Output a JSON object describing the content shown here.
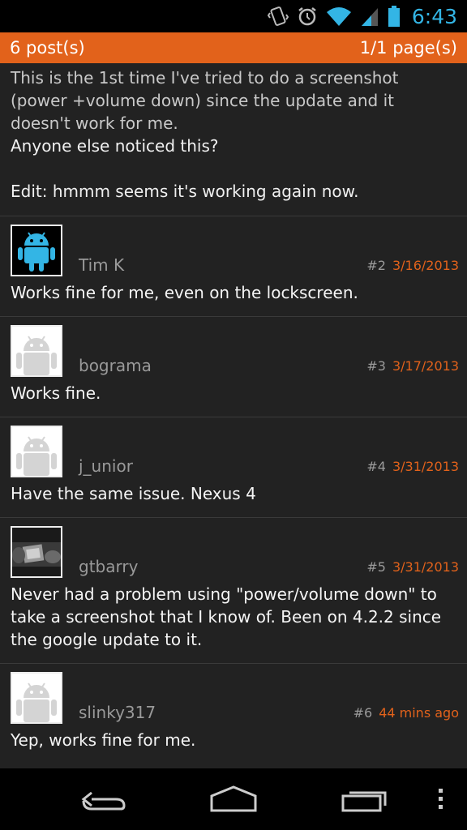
{
  "status_bar": {
    "time": "6:43",
    "icons": [
      "vibrate-icon",
      "alarm-icon",
      "wifi-icon",
      "signal-icon",
      "battery-icon"
    ],
    "accent_color": "#33b5e5"
  },
  "header": {
    "posts_count": "6 post(s)",
    "pages": "1/1 page(s)",
    "color": "#e2621b"
  },
  "first_post": {
    "line1": "This is the 1st time I've tried to do a screenshot (power +volume down) since the update and it doesn't work for me.",
    "line2": "Anyone else noticed this?",
    "line3": "Edit: hmmm seems it's working again now."
  },
  "posts": [
    {
      "author": "Tim K",
      "num": "#2",
      "date": "3/16/2013",
      "body": "Works fine for me, even on the lockscreen.",
      "avatar": "android-blue-icon"
    },
    {
      "author": "bograma",
      "num": "#3",
      "date": "3/17/2013",
      "body": "Works fine.",
      "avatar": "android-default-icon"
    },
    {
      "author": "j_unior",
      "num": "#4",
      "date": "3/31/2013",
      "body": "Have the same issue. Nexus 4",
      "avatar": "android-default-icon"
    },
    {
      "author": "gtbarry",
      "num": "#5",
      "date": "3/31/2013",
      "body": "Never had a problem using \"power/volume down\" to take a screenshot that I know of. Been on 4.2.2 since the google update to it.",
      "avatar": "photo-avatar"
    },
    {
      "author": "slinky317",
      "num": "#6",
      "date": "44 mins ago",
      "body": "Yep, works fine for me.",
      "avatar": "android-default-icon"
    }
  ],
  "nav_bar": {
    "buttons": [
      "back-icon",
      "home-icon",
      "recents-icon",
      "menu-icon"
    ]
  }
}
